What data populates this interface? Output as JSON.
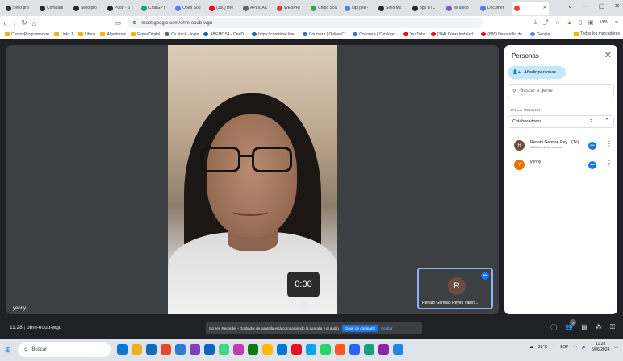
{
  "browser": {
    "tabs": [
      {
        "label": "Sello pro",
        "color": "#333333"
      },
      {
        "label": "Comparti",
        "color": "#24292f"
      },
      {
        "label": "Sello pro",
        "color": "#24292f"
      },
      {
        "label": "Pular - S",
        "color": "#24292f"
      },
      {
        "label": "ChatGPT",
        "color": "#10a37f"
      },
      {
        "label": "Open Sou",
        "color": "#4285f4"
      },
      {
        "label": "(350) Hre",
        "color": "#ff0000"
      },
      {
        "label": "APLICAC",
        "color": "#5f6368"
      },
      {
        "label": "WEBPRI",
        "color": "#e53935"
      },
      {
        "label": "Chipo Sou",
        "color": "#34a853"
      },
      {
        "label": "Lipi pse -",
        "color": "#4285f4"
      },
      {
        "label": "Sello Mo",
        "color": "#24292f"
      },
      {
        "label": "ops BTC",
        "color": "#24292f"
      },
      {
        "label": "Mi unico",
        "color": "#7e57c2"
      },
      {
        "label": "Documen",
        "color": "#4285f4"
      }
    ],
    "active_tab": {
      "label": "",
      "color": "#ea4335"
    },
    "url": "meet.google.com/ohm-eoub-wgu",
    "vpn_label": "VPN",
    "bookmarks": [
      {
        "label": "CursosProgramacion",
        "icon": "folder-icon"
      },
      {
        "label": "Links 1",
        "icon": "folder-icon"
      },
      {
        "label": "Libros",
        "icon": "folder-icon"
      },
      {
        "label": "Algoritmos",
        "icon": "folder-icon"
      },
      {
        "label": "Firma Digital",
        "icon": "folder-icon"
      },
      {
        "label": "Cv stack - login",
        "icon": "globe-icon"
      },
      {
        "label": "ABEMOS4 - OneD...",
        "icon": "cloud-icon"
      },
      {
        "label": "https://coredrive.live...",
        "icon": "cloud-icon"
      },
      {
        "label": "Coursera | Online C...",
        "icon": "coursera-icon"
      },
      {
        "label": "Coursera | Catalogo...",
        "icon": "coursera-icon"
      },
      {
        "label": "YouTube",
        "icon": "youtube-icon"
      },
      {
        "label": "(344) Crear Instalad...",
        "icon": "youtube-icon"
      },
      {
        "label": "(688) Desarrollo de...",
        "icon": "youtube-icon"
      },
      {
        "label": "Google",
        "icon": "google-icon"
      }
    ],
    "all_bookmarks_label": "Todos los marcadores"
  },
  "meet": {
    "main_participant_name": "yenny",
    "timer": "0:00",
    "self_tile": {
      "initial": "R",
      "name": "Renato German Reyes Valen..."
    },
    "panel": {
      "title": "Personas",
      "add_label": "Añadir personas",
      "search_placeholder": "Buscar a gente",
      "section_label": "EN LA REUNIÓN",
      "group_label": "Colaboradores",
      "group_count": "2",
      "participants": [
        {
          "initial": "R",
          "name": "Renato German Rey...  (Tú)",
          "subtitle": "Anfitrión de la reunión",
          "color": "#6d4c41"
        },
        {
          "initial": "Y",
          "name": "yenny",
          "subtitle": "",
          "color": "#e8710a"
        }
      ]
    },
    "bottom": {
      "time": "11:28",
      "meeting_code": "ohm-eoub-wgu",
      "share_text": "Screen Recorder - Grabador de pantalla está compartiendo la pantalla y el audio.",
      "stop_label": "Dejar de compartir",
      "hide_label": "Ocultar",
      "people_count": "2"
    }
  },
  "taskbar": {
    "search_label": "Buscar",
    "temperature": "21°C",
    "time": "11:28",
    "date": "6/06/2024",
    "lang": "ESP",
    "apps": [
      "#0078d4",
      "#f2b01e",
      "#0f6cbd",
      "#e34c26",
      "#2b7cd3",
      "#7f3fbf",
      "#0a66c2",
      "#3ddc84",
      "#c239b3",
      "#107c10",
      "#ffb900",
      "#0078d4",
      "#e81123",
      "#00a4ef",
      "#25d366",
      "#ff5722",
      "#2962ff",
      "#16a085",
      "#8e24aa",
      "#1e88e5"
    ]
  }
}
